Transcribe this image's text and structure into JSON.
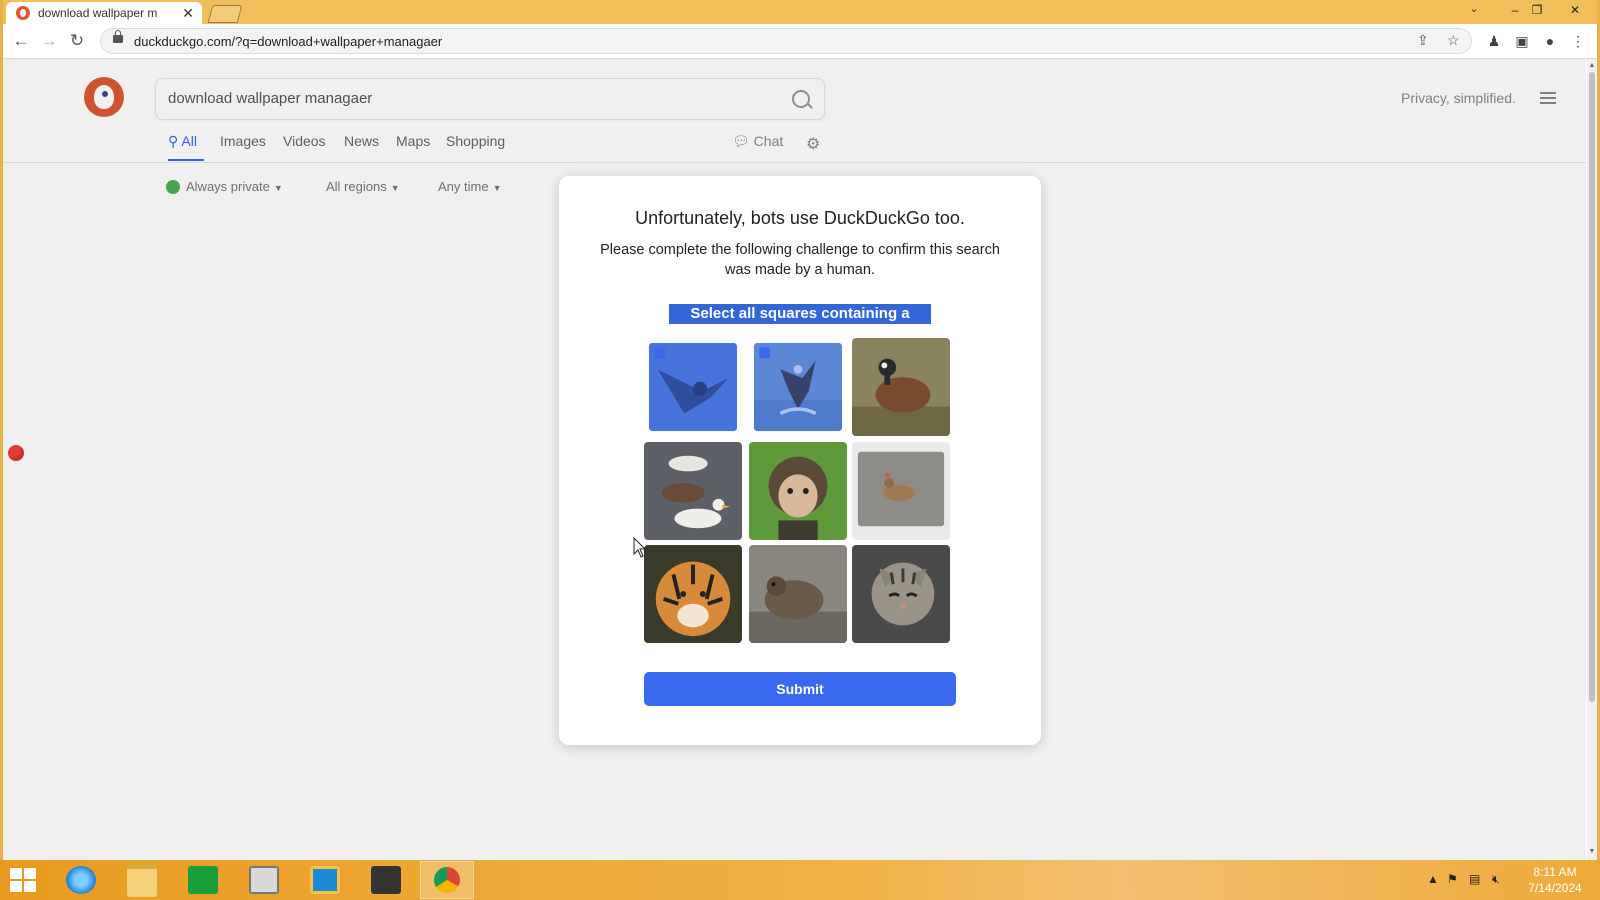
{
  "browser": {
    "tab_title": "download wallpaper m",
    "tab_close": "✕",
    "url": "duckduckgo.com/?q=download+wallpaper+managaer",
    "window_controls": {
      "minimize": "–",
      "restore": "❐",
      "close": "✕"
    },
    "tab_menu": "⌄"
  },
  "page": {
    "search_value": "download wallpaper managaer",
    "privacy_text": "Privacy, simplified.",
    "nav_tabs": [
      {
        "label": "All",
        "active": true
      },
      {
        "label": "Images"
      },
      {
        "label": "Videos"
      },
      {
        "label": "News"
      },
      {
        "label": "Maps"
      },
      {
        "label": "Shopping"
      }
    ],
    "chat_label": "Chat",
    "filters": {
      "privacy": "Always private",
      "region": "All regions",
      "time": "Any time"
    }
  },
  "modal": {
    "title": "Unfortunately, bots use DuckDuckGo too.",
    "subtitle": "Please complete the following challenge to confirm this search was made by a human.",
    "instruction": "Select all squares containing a duck:",
    "submit_label": "Submit",
    "grid": [
      {
        "subject": "blue bird in flight",
        "selected": true
      },
      {
        "subject": "eagle over water",
        "selected": true
      },
      {
        "subject": "whistling duck standing",
        "selected": false
      },
      {
        "subject": "ducks swimming",
        "selected": false
      },
      {
        "subject": "monkey",
        "selected": false
      },
      {
        "subject": "duck on water",
        "selected": false
      },
      {
        "subject": "tiger",
        "selected": false
      },
      {
        "subject": "marmot on rocks",
        "selected": false
      },
      {
        "subject": "tabby cat",
        "selected": false
      }
    ]
  },
  "taskbar": {
    "time": "8:11 AM",
    "date": "7/14/2024"
  },
  "colors": {
    "accent": "#3969ef",
    "ddg_orange": "#de5833",
    "instruction_highlight": "#3366d6"
  }
}
